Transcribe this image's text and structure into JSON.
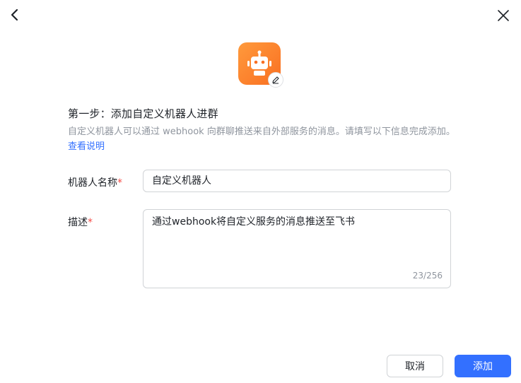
{
  "header": {
    "back_icon": "chevron-left-icon",
    "close_icon": "close-icon"
  },
  "avatar": {
    "icon": "robot-icon",
    "edit_icon": "pencil-icon",
    "color_start": "#ff9a3c",
    "color_end": "#f96f22"
  },
  "step": {
    "title": "第一步：添加自定义机器人进群",
    "description": "自定义机器人可以通过 webhook 向群聊推送来自外部服务的消息。请填写以下信息完成添加。",
    "link_text": "查看说明"
  },
  "form": {
    "name_label": "机器人名称",
    "name_value": "自定义机器人",
    "desc_label": "描述",
    "desc_value": "通过webhook将自定义服务的消息推送至飞书",
    "desc_counter": "23/256",
    "required_mark": "*"
  },
  "footer": {
    "cancel_label": "取消",
    "add_label": "添加"
  },
  "colors": {
    "primary": "#3370ff",
    "required": "#f54a45"
  }
}
